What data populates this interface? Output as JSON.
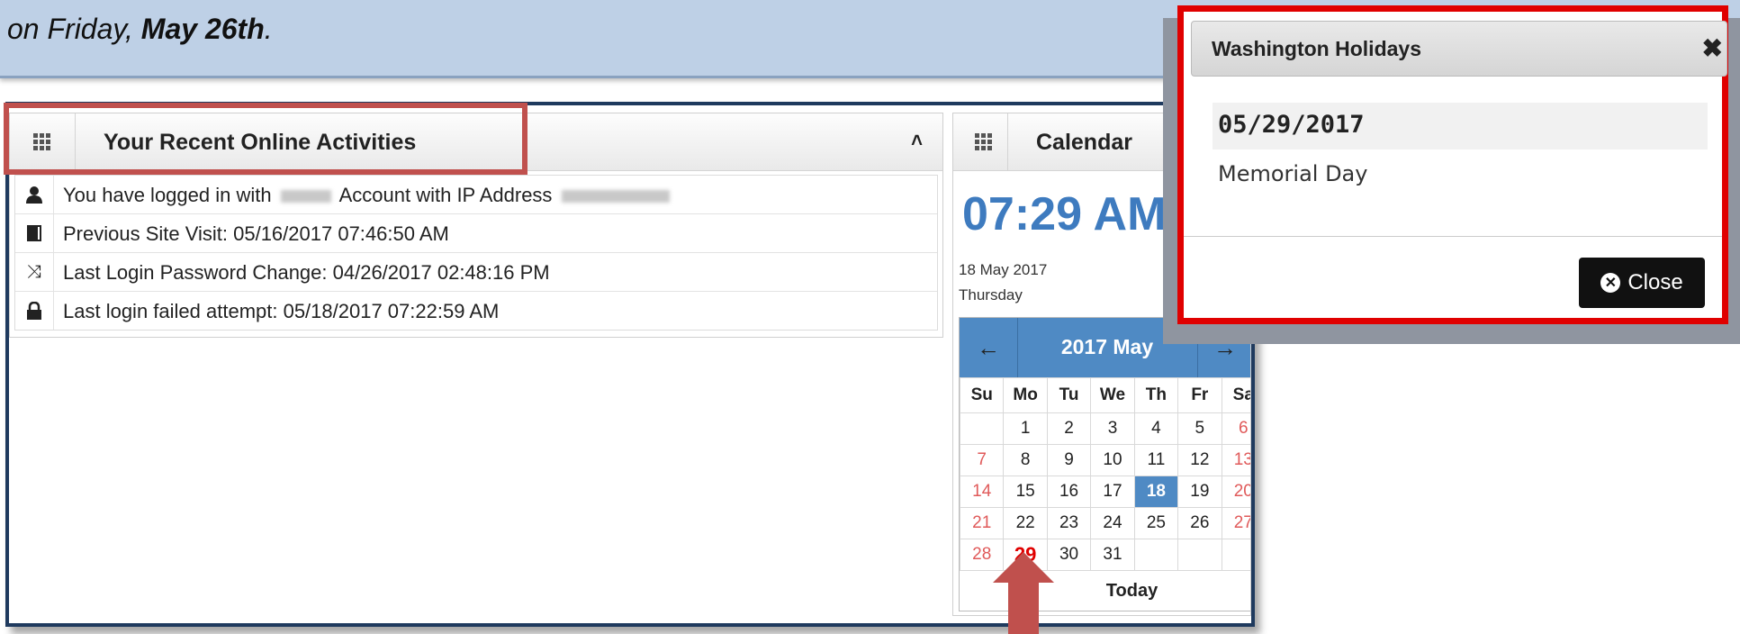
{
  "banner": {
    "text_prefix": "on Friday, ",
    "text_bold": "May 26th",
    "text_suffix": "."
  },
  "activities": {
    "title": "Your Recent Online Activities",
    "rows": [
      {
        "icon": "user-icon",
        "text_a": "You have logged in with ",
        "text_b": " Account with IP Address "
      },
      {
        "icon": "book-icon",
        "text": "Previous Site Visit: 05/16/2017 07:46:50 AM"
      },
      {
        "icon": "random-icon",
        "text": "Last Login Password Change: 04/26/2017 02:48:16 PM"
      },
      {
        "icon": "lock-icon",
        "text": "Last login failed attempt: 05/18/2017 07:22:59 AM"
      }
    ]
  },
  "calendar": {
    "title": "Calendar",
    "time": "07:29 AM",
    "date": "18 May 2017",
    "weekday": "Thursday",
    "month_title": "2017 May",
    "prev_icon": "arrow-left-icon",
    "next_icon": "arrow-right-icon",
    "day_headers": [
      "Su",
      "Mo",
      "Tu",
      "We",
      "Th",
      "Fr",
      "Sa"
    ],
    "weeks": [
      [
        "",
        "1",
        "2",
        "3",
        "4",
        "5",
        "6"
      ],
      [
        "7",
        "8",
        "9",
        "10",
        "11",
        "12",
        "13"
      ],
      [
        "14",
        "15",
        "16",
        "17",
        "18",
        "19",
        "20"
      ],
      [
        "21",
        "22",
        "23",
        "24",
        "25",
        "26",
        "27"
      ],
      [
        "28",
        "29",
        "30",
        "31",
        "",
        "",
        ""
      ]
    ],
    "selected_day": "18",
    "holiday_day": "29",
    "today_label": "Today",
    "colors": {
      "accent": "#4f8ac4",
      "weekend": "#e05a5a",
      "holiday": "#e00000"
    }
  },
  "modal": {
    "title": "Washington Holidays",
    "holiday_date": "05/29/2017",
    "holiday_name": "Memorial Day",
    "close_label": "Close",
    "highlight_color": "#e00000"
  },
  "annotation_color": "#c0504d"
}
